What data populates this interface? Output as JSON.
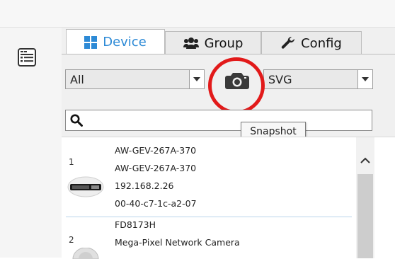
{
  "tabs": [
    {
      "label": "Device",
      "icon": "grid-icon",
      "active": true
    },
    {
      "label": "Group",
      "icon": "users-icon",
      "active": false
    },
    {
      "label": "Config",
      "icon": "wrench-icon",
      "active": false
    }
  ],
  "filter": {
    "selected": "All",
    "layout_selected": "SVG"
  },
  "tooltip": {
    "text": "Snapshot"
  },
  "devices": [
    {
      "index": "1",
      "lines": [
        "AW-GEV-267A-370",
        "AW-GEV-267A-370",
        "192.168.2.26",
        "00-40-c7-1c-a2-07"
      ]
    },
    {
      "index": "2",
      "lines": [
        "FD8173H",
        "Mega-Pixel Network Camera"
      ]
    }
  ],
  "colors": {
    "accent": "#2d8ad6",
    "highlight": "#e21a1a"
  }
}
